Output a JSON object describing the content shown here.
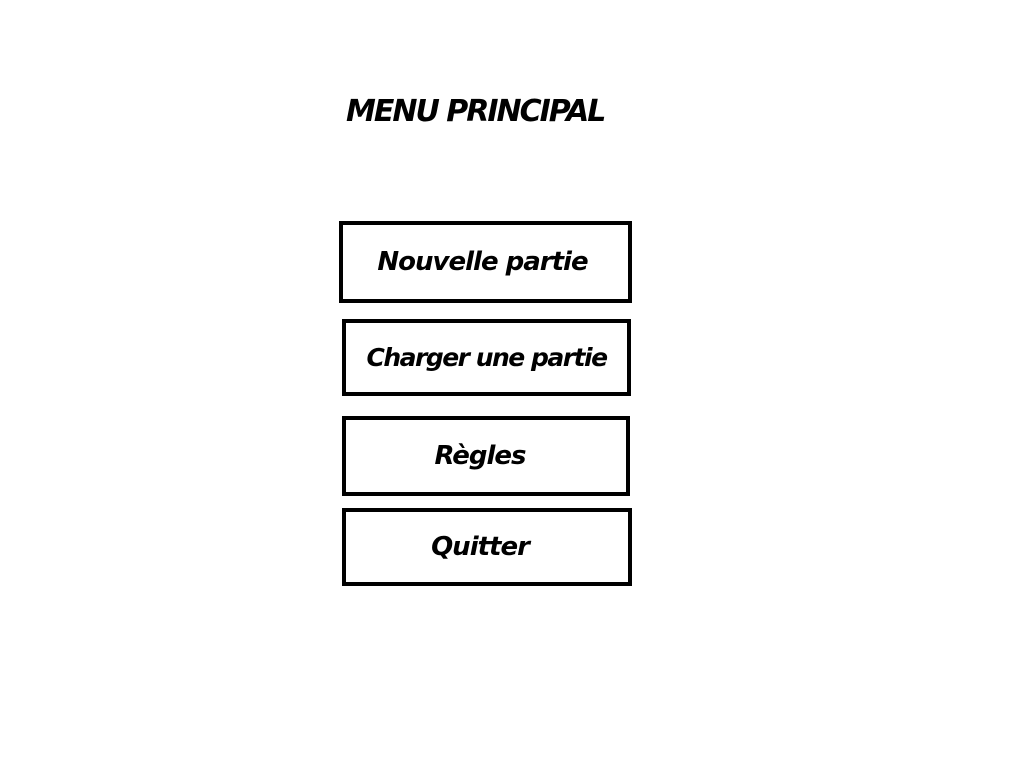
{
  "menu": {
    "title": "MENU PRINCIPAL",
    "buttons": [
      {
        "label": "Nouvelle partie"
      },
      {
        "label": "Charger une partie"
      },
      {
        "label": "Règles"
      },
      {
        "label": "Quitter"
      }
    ]
  },
  "colors": {
    "background": "#ffffff",
    "text": "#000000",
    "border": "#000000"
  }
}
